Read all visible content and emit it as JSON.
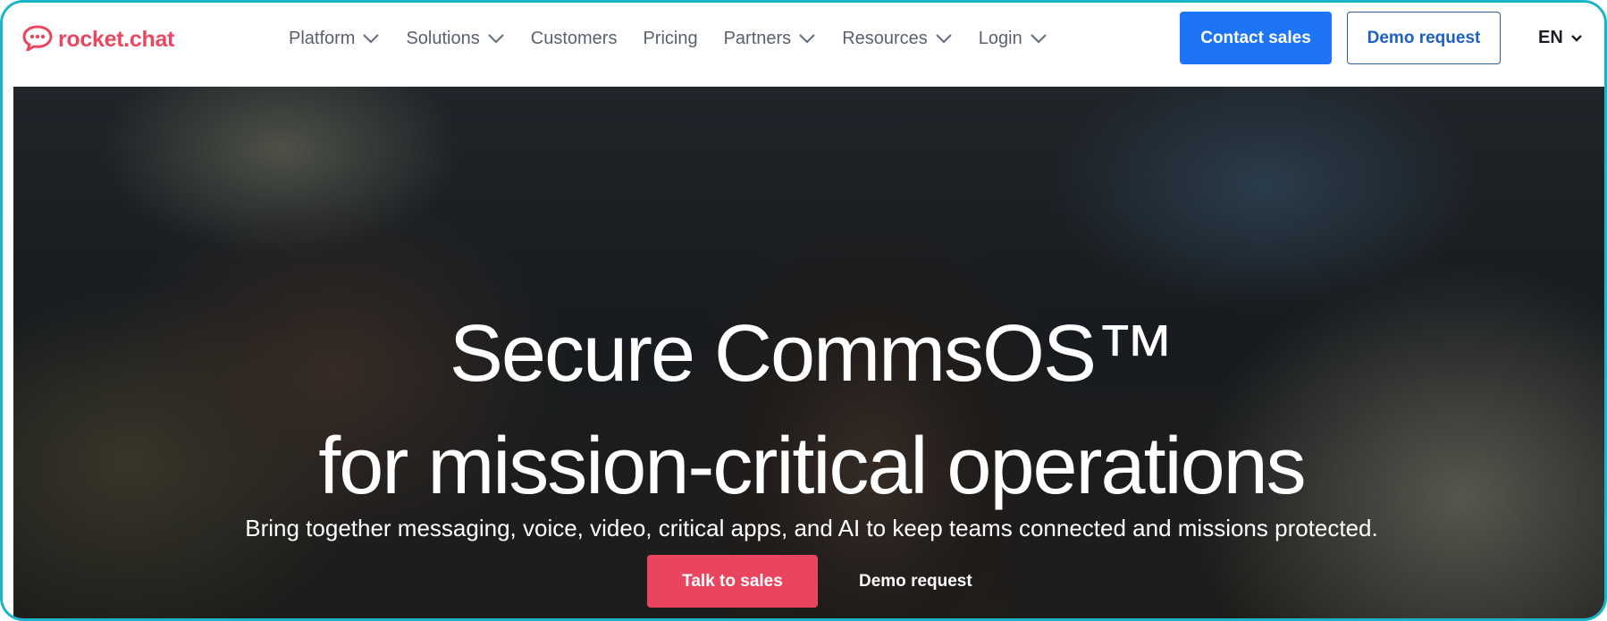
{
  "header": {
    "logo_text": "rocket.chat",
    "logo_icon": "rocket-chat-bubble-icon",
    "nav": [
      {
        "label": "Platform",
        "has_dropdown": true
      },
      {
        "label": "Solutions",
        "has_dropdown": true
      },
      {
        "label": "Customers",
        "has_dropdown": false
      },
      {
        "label": "Pricing",
        "has_dropdown": false
      },
      {
        "label": "Partners",
        "has_dropdown": true
      },
      {
        "label": "Resources",
        "has_dropdown": true
      },
      {
        "label": "Login",
        "has_dropdown": true
      }
    ],
    "contact_sales_label": "Contact sales",
    "demo_request_label": "Demo request",
    "language": "EN"
  },
  "hero": {
    "title_line1": "Secure CommsOS™",
    "title_line2": "for mission-critical operations",
    "subtitle": "Bring together messaging, voice, video, critical apps, and AI to keep teams connected and missions protected.",
    "cta_primary": "Talk to sales",
    "cta_secondary": "Demo request"
  },
  "colors": {
    "brand": "#e8475f",
    "primary_button": "#1d74f5",
    "frame_border": "#19b4c8"
  }
}
